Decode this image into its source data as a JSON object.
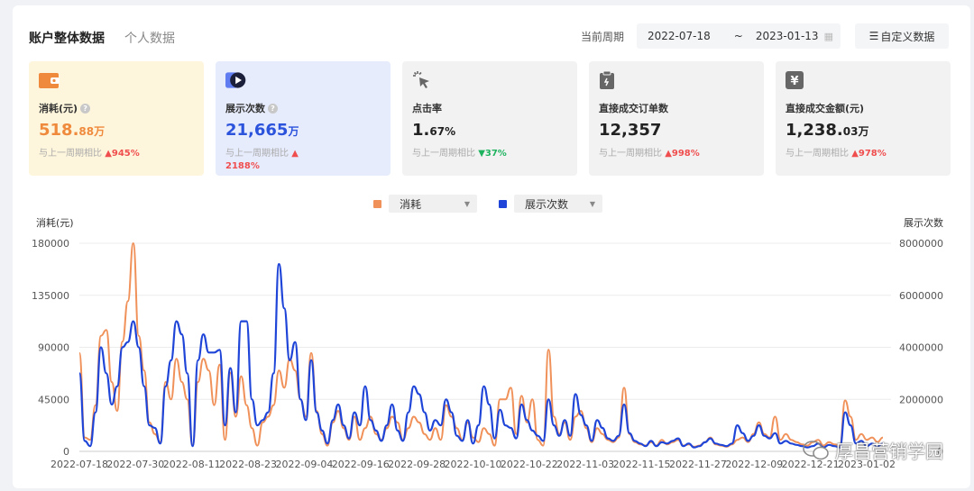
{
  "tabs": [
    "账户整体数据",
    "个人数据"
  ],
  "period": {
    "label": "当前周期",
    "start": "2022-07-18",
    "sep": "~",
    "end": "2023-01-13",
    "custom_button": "自定义数据"
  },
  "cards": [
    {
      "label": "消耗(元)",
      "value_main": "518.",
      "value_small": "88万",
      "cmp_text": "与上一周期相比",
      "cmp_value": "▲945%",
      "icon": "wallet-icon"
    },
    {
      "label": "展示次数",
      "value_main": "21,665",
      "value_small": "万",
      "cmp_text": "与上一周期相比",
      "cmp_value": "▲",
      "cmp_value2": "2188%",
      "icon": "play-icon"
    },
    {
      "label": "点击率",
      "value_main": "1.",
      "value_small": "67%",
      "cmp_text": "与上一周期相比",
      "cmp_value": "▼37%",
      "icon": "cursor-click-icon"
    },
    {
      "label": "直接成交订单数",
      "value_main": "12,357",
      "value_small": "",
      "cmp_text": "与上一周期相比",
      "cmp_value": "▲998%",
      "icon": "clipboard-icon"
    },
    {
      "label": "直接成交金额(元)",
      "value_main": "1,238.",
      "value_small": "03万",
      "cmp_text": "与上一周期相比",
      "cmp_value": "▲978%",
      "icon": "yen-icon"
    }
  ],
  "colors": {
    "accent_orange": "#f0915a",
    "accent_blue": "#1f45d8",
    "up": "#f04e4e",
    "down": "#1db35e"
  },
  "legend": [
    {
      "name": "消耗",
      "color": "#f0915a"
    },
    {
      "name": "展示次数",
      "color": "#1f45d8"
    }
  ],
  "watermark": "厚昌营销学园",
  "chart_data": {
    "type": "line",
    "ylabel": "消耗(元)",
    "y2label": "展示次数",
    "ylim": [
      0,
      180000
    ],
    "y2lim": [
      0,
      8000000
    ],
    "yticks": [
      "0",
      "45000",
      "90000",
      "135000",
      "180000"
    ],
    "y2ticks": [
      "0",
      "2000000",
      "4000000",
      "6000000",
      "8000000"
    ],
    "xticks": [
      "2022-07-18",
      "2022-07-30",
      "2022-08-11",
      "2022-08-23",
      "2022-09-04",
      "2022-09-16",
      "2022-09-28",
      "2022-10-10",
      "2022-10-22",
      "2022-11-03",
      "2022-11-15",
      "2022-11-27",
      "2022-12-09",
      "2022-12-21",
      "2023-01-02"
    ],
    "grid": true,
    "series": [
      {
        "name": "消耗",
        "axis": "left",
        "values": [
          85000,
          12000,
          10000,
          40000,
          100000,
          105000,
          60000,
          35000,
          95000,
          130000,
          180000,
          100000,
          70000,
          25000,
          15000,
          8000,
          60000,
          45000,
          80000,
          60000,
          45000,
          5000,
          60000,
          80000,
          70000,
          40000,
          75000,
          10000,
          68000,
          30000,
          65000,
          40000,
          20000,
          5000,
          25000,
          30000,
          40000,
          70000,
          55000,
          80000,
          70000,
          45000,
          30000,
          85000,
          35000,
          15000,
          5000,
          25000,
          35000,
          20000,
          10000,
          30000,
          10000,
          20000,
          30000,
          15000,
          10000,
          20000,
          30000,
          25000,
          10000,
          20000,
          30000,
          25000,
          15000,
          10000,
          20000,
          10000,
          40000,
          30000,
          20000,
          10000,
          25000,
          12000,
          8000,
          20000,
          15000,
          5000,
          45000,
          45000,
          55000,
          15000,
          48000,
          25000,
          45000,
          10000,
          5000,
          88000,
          30000,
          15000,
          25000,
          10000,
          30000,
          35000,
          20000,
          8000,
          20000,
          15000,
          10000,
          8000,
          12000,
          55000,
          15000,
          8000,
          6000,
          5000,
          8000,
          5000,
          10000,
          6000,
          8000,
          10000,
          5000,
          6000,
          4000,
          5000,
          8000,
          12000,
          6000,
          5000,
          4000,
          6000,
          10000,
          12000,
          8000,
          15000,
          25000,
          15000,
          12000,
          30000,
          10000,
          15000,
          10000,
          8000,
          6000,
          5000,
          8000,
          10000,
          5000,
          8000,
          6000,
          5000,
          44000,
          30000,
          10000,
          15000,
          10000,
          12000,
          8000,
          12000
        ]
      },
      {
        "name": "展示次数",
        "axis": "right",
        "values": [
          3000000,
          400000,
          200000,
          1500000,
          4000000,
          3000000,
          1800000,
          2500000,
          4000000,
          4200000,
          5000000,
          4000000,
          2500000,
          1000000,
          900000,
          300000,
          2500000,
          3500000,
          5000000,
          4500000,
          3000000,
          200000,
          3500000,
          4500000,
          3800000,
          3800000,
          3900000,
          1000000,
          3200000,
          1500000,
          5000000,
          5000000,
          2000000,
          1000000,
          1200000,
          1500000,
          3000000,
          7200000,
          5500000,
          3500000,
          4200000,
          2000000,
          1200000,
          3500000,
          1500000,
          800000,
          300000,
          1200000,
          1800000,
          1000000,
          500000,
          1500000,
          1000000,
          2500000,
          1200000,
          800000,
          400000,
          1000000,
          1800000,
          800000,
          400000,
          1500000,
          2500000,
          2200000,
          1500000,
          800000,
          1200000,
          1000000,
          2000000,
          1500000,
          600000,
          400000,
          1200000,
          300000,
          1000000,
          2500000,
          1800000,
          500000,
          1600000,
          1000000,
          900000,
          500000,
          1800000,
          1200000,
          800000,
          600000,
          400000,
          2000000,
          1000000,
          600000,
          1200000,
          600000,
          2200000,
          1400000,
          1000000,
          400000,
          1200000,
          900000,
          500000,
          400000,
          600000,
          1800000,
          700000,
          400000,
          300000,
          200000,
          400000,
          200000,
          350000,
          300000,
          400000,
          500000,
          200000,
          300000,
          150000,
          200000,
          350000,
          500000,
          300000,
          250000,
          200000,
          300000,
          1000000,
          700000,
          400000,
          600000,
          1000000,
          600000,
          500000,
          700000,
          300000,
          400000,
          300000,
          250000,
          200000,
          150000,
          200000,
          300000,
          150000,
          250000,
          200000,
          150000,
          1500000,
          1000000,
          300000,
          400000,
          200000,
          300000,
          200000,
          300000
        ]
      }
    ]
  }
}
